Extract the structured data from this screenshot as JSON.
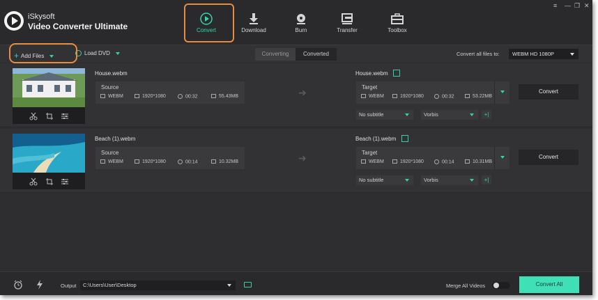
{
  "app": {
    "brand_line1": "iSkysoft",
    "brand_line2": "Video Converter Ultimate",
    "window_controls": [
      "≡",
      "—",
      "❐",
      "✕"
    ]
  },
  "nav": [
    {
      "label": "Convert",
      "icon": "convert-icon",
      "active": true
    },
    {
      "label": "Download",
      "icon": "download-icon",
      "active": false
    },
    {
      "label": "Burn",
      "icon": "burn-icon",
      "active": false
    },
    {
      "label": "Transfer",
      "icon": "transfer-icon",
      "active": false
    },
    {
      "label": "Toolbox",
      "icon": "toolbox-icon",
      "active": false
    }
  ],
  "subbar": {
    "add_files": "Add Files",
    "load_dvd": "Load DVD",
    "tab_converting": "Converting",
    "tab_converted": "Converted",
    "convert_all_label": "Convert all files to:",
    "format": "WEBM HD 1080P"
  },
  "files": [
    {
      "name": "House.webm",
      "source_title": "Source",
      "source": {
        "format": "WEBM",
        "resolution": "1920*1080",
        "duration": "00:32",
        "size": "55.43MB"
      },
      "target_name": "House.webm",
      "target_title": "Target",
      "target": {
        "format": "WEBM",
        "resolution": "1920*1080",
        "duration": "00:32",
        "size": "53.22MB"
      },
      "subtitle": "No subtitle",
      "audio": "Vorbis",
      "convert_label": "Convert"
    },
    {
      "name": "Beach (1).webm",
      "source_title": "Source",
      "source": {
        "format": "WEBM",
        "resolution": "1920*1080",
        "duration": "00:14",
        "size": "10.32MB"
      },
      "target_name": "Beach (1).webm",
      "target_title": "Target",
      "target": {
        "format": "WEBM",
        "resolution": "1920*1080",
        "duration": "00:14",
        "size": "10.31MB"
      },
      "subtitle": "No subtitle",
      "audio": "Vorbis",
      "convert_label": "Convert"
    }
  ],
  "bottom": {
    "output_label": "Output",
    "output_path": "C:\\Users\\User\\Desktop",
    "merge_label": "Merge All Videos",
    "merge_enabled": false,
    "convert_all_button": "Convert All"
  },
  "colors": {
    "accent": "#3fe0b6",
    "highlight": "#e88c3d",
    "background": "#2e2e31"
  }
}
